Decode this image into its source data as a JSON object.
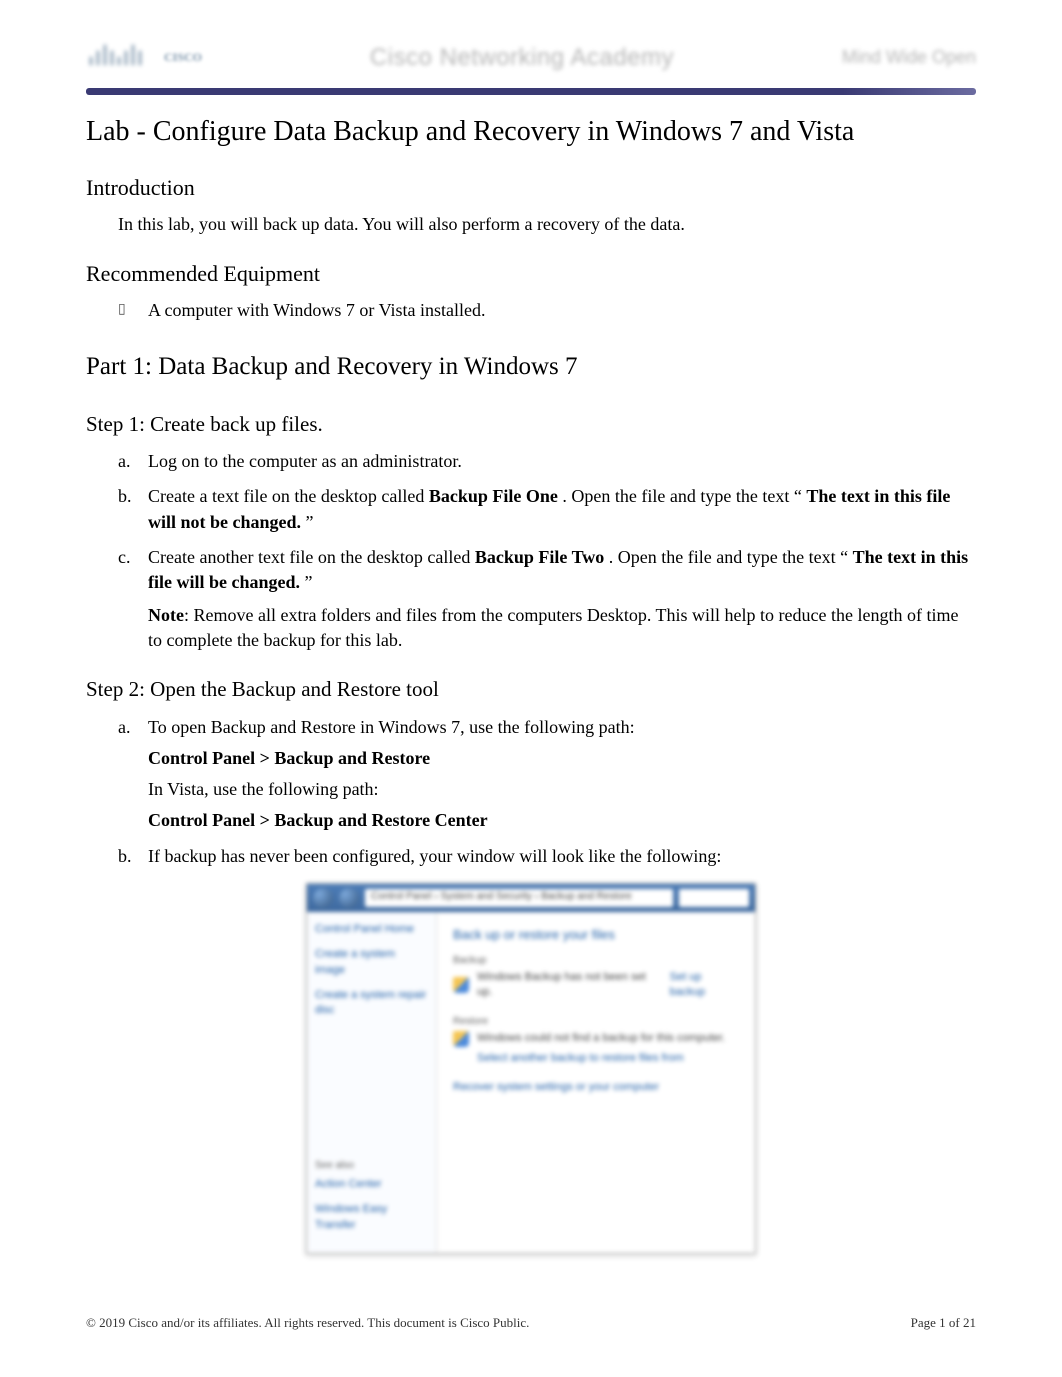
{
  "header": {
    "logo_top": "CISCO",
    "academy": "Cisco Networking Academy",
    "mind": "Mind Wide Open"
  },
  "title": "Lab - Configure Data Backup and Recovery in Windows 7 and Vista",
  "intro_heading": "Introduction",
  "intro_text": "In this lab, you will back up data. You will also perform a recovery of the data.",
  "equip_heading": "Recommended Equipment",
  "equip_item": "A computer with Windows 7 or Vista installed.",
  "part1_heading": "Part 1: Data Backup and Recovery in Windows 7",
  "step1": {
    "heading": "Step 1: Create back up files.",
    "a": "Log on to the computer as an administrator.",
    "b_pre": "Create a text file on the desktop called ",
    "b_file": "Backup File One",
    "b_mid": ". Open the file and type the text “",
    "b_quote": "The text in this file will not be changed.",
    "b_end": "”",
    "c_pre": "Create another text file on the desktop called ",
    "c_file": "Backup File Two",
    "c_mid": ". Open the file and type the text “",
    "c_quote": "The text in this file will be changed.",
    "c_end": "”",
    "note_label": "Note",
    "note_text": ": Remove all extra folders and files from the computers Desktop. This will help to reduce the length of time to complete the backup for this lab."
  },
  "step2": {
    "heading": "Step 2: Open the Backup and Restore tool",
    "a_intro": "To open Backup and Restore in Windows 7, use the following path:",
    "a_path7": "Control Panel > Backup and Restore",
    "a_vista_intro": "In Vista, use the following path:",
    "a_path_vista": "Control Panel > Backup and Restore Center",
    "b": "If backup has never been configured, your window will look like the following:"
  },
  "screenshot": {
    "path": "Control Panel › System and Security › Backup and Restore",
    "side_link1": "Control Panel Home",
    "side_link2": "Create a system image",
    "side_link3": "Create a system repair disc",
    "side_seealso": "See also",
    "side_link4": "Action Center",
    "side_link5": "Windows Easy Transfer",
    "main_heading": "Back up or restore your files",
    "backup_label": "Backup",
    "backup_text": "Windows Backup has not been set up.",
    "setup_link": "Set up backup",
    "restore_label": "Restore",
    "restore_text1": "Windows could not find a backup for this computer.",
    "restore_text2": "Select another backup to restore files from",
    "recover_link": "Recover system settings or your computer"
  },
  "footer": {
    "copyright": "© 2019 Cisco and/or its affiliates. All rights reserved. This document is Cisco Public.",
    "page_label": "Page",
    "page_current": "1",
    "page_of": "of",
    "page_total": "21"
  }
}
